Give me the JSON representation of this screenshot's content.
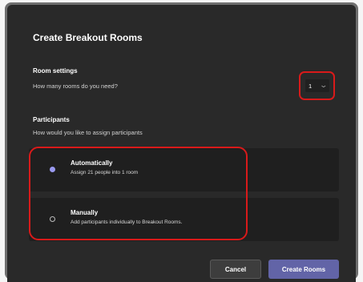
{
  "dialog": {
    "title": "Create Breakout Rooms"
  },
  "room_settings": {
    "label": "Room settings",
    "question": "How many rooms do you need?",
    "rooms_value": "1"
  },
  "participants": {
    "label": "Participants",
    "question": "How would you like to assign participants"
  },
  "options": [
    {
      "title": "Automatically",
      "description": "Assign 21 people into 1 room",
      "selected": true
    },
    {
      "title": "Manually",
      "description": "Add participants individually to Breakout Rooms.",
      "selected": false
    }
  ],
  "buttons": {
    "cancel": "Cancel",
    "create": "Create Rooms"
  },
  "colors": {
    "accent": "#6264a7",
    "highlight": "#d91a1a",
    "dialog_bg": "#292929"
  },
  "icons": {
    "dropdown": "chevron-down-icon"
  }
}
